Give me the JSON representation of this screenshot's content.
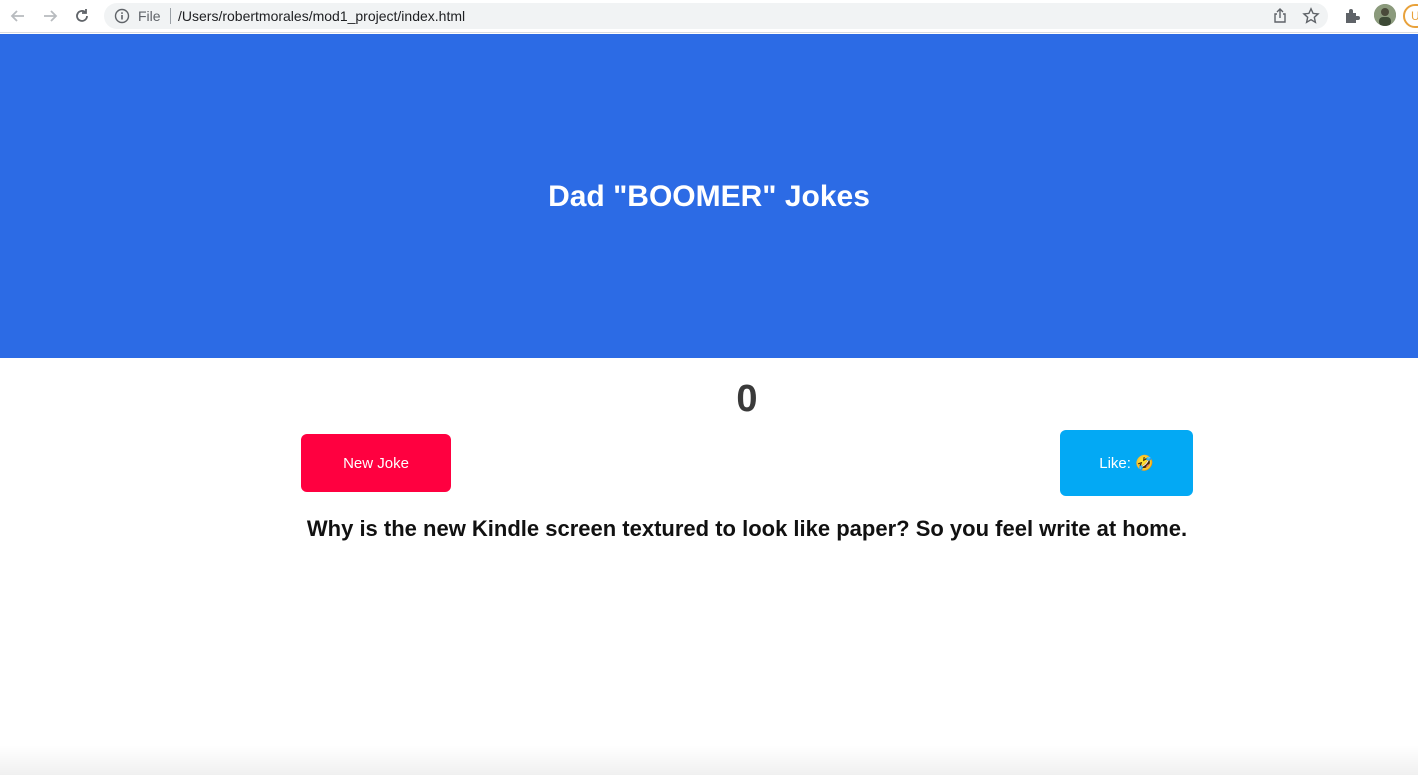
{
  "browser": {
    "scheme_label": "File",
    "url": "/Users/robertmorales/mod1_project/index.html",
    "icons": [
      "back-arrow-icon",
      "forward-arrow-icon",
      "reload-icon",
      "info-icon",
      "share-icon",
      "star-icon",
      "extensions-icon"
    ],
    "profile_initial": "U"
  },
  "page": {
    "title": "Dad \"BOOMER\" Jokes",
    "counter": "0",
    "new_joke_label": "New Joke",
    "like_label": "Like: 🤣",
    "joke_text": "Why is the new Kindle screen textured to look like paper? So you feel write at home."
  },
  "colors": {
    "hero_background": "#2c6be5",
    "new_joke_button": "#ff0040",
    "like_button": "#03a9f4"
  }
}
